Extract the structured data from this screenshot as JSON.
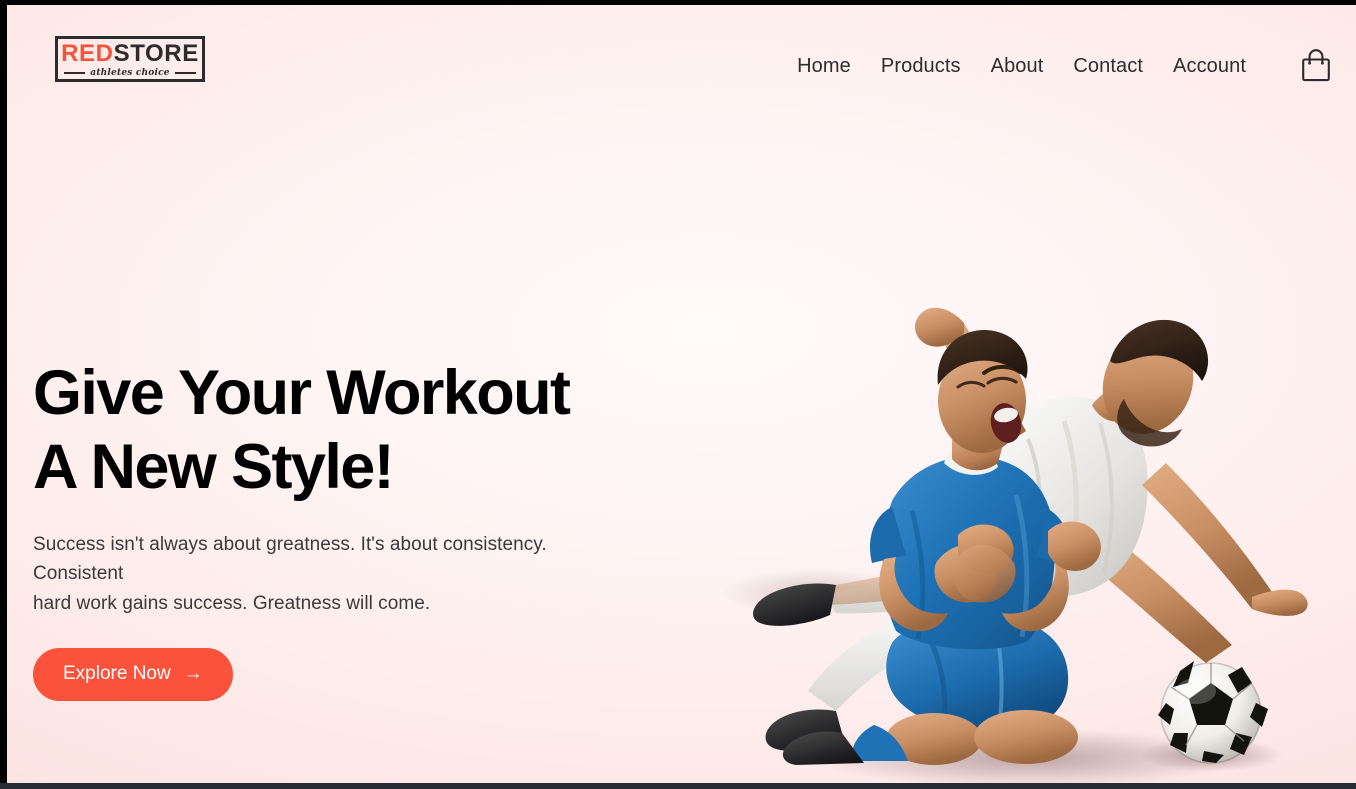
{
  "brand": {
    "name_part_red": "RED",
    "name_part_dark": "STORE",
    "tagline": "athletes choice",
    "accent_color": "#f4543c",
    "ink_color": "#2c2c2c"
  },
  "nav": {
    "items": [
      {
        "label": "Home"
      },
      {
        "label": "Products"
      },
      {
        "label": "About"
      },
      {
        "label": "Contact"
      },
      {
        "label": "Account"
      }
    ],
    "cart_icon": "shopping-bag-icon"
  },
  "hero": {
    "title": "Give Your Workout\nA New Style!",
    "subtitle": "Success isn't always about greatness. It's about consistency. Consistent\nhard work gains success. Greatness will come.",
    "cta_label": "Explore Now",
    "cta_arrow": "→",
    "cta_color": "#fb523b",
    "background_color": "#fce3e1",
    "artwork": {
      "name": "two-athletes-celebrating-with-soccer-ball",
      "elements": [
        "kneeling-footballer-blue-kit",
        "diving-footballer-white-kit",
        "soccer-ball"
      ],
      "blue_kit_color": "#1f6fb2",
      "white_kit_color": "#ededeb"
    }
  }
}
